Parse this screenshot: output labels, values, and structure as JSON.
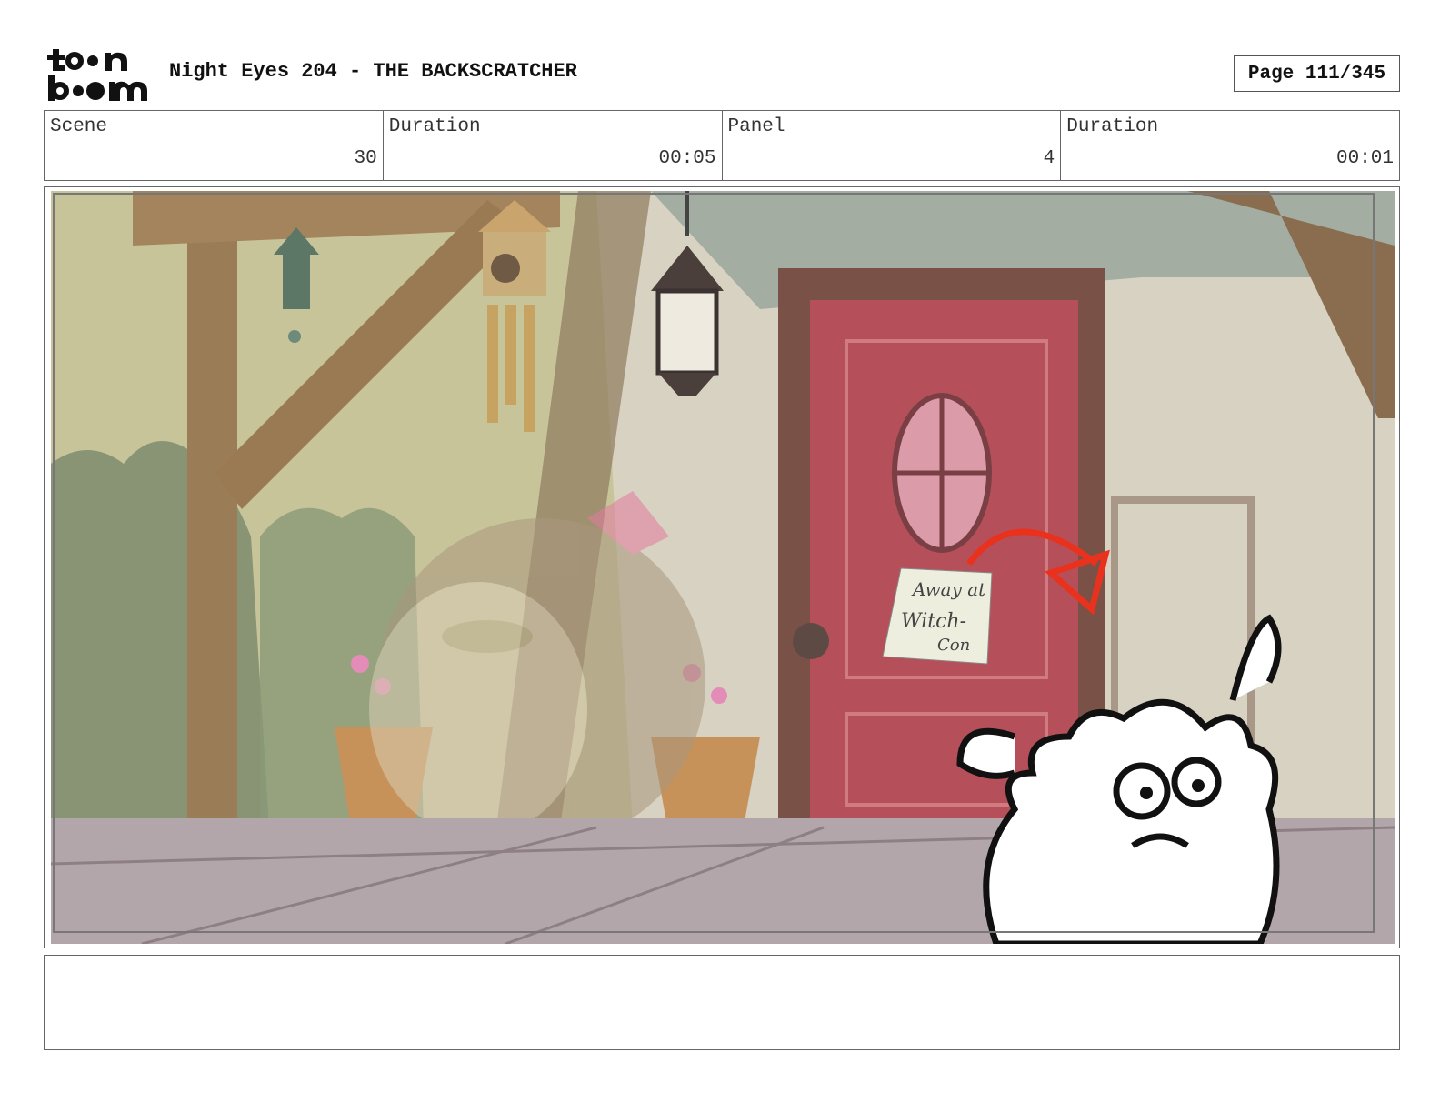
{
  "header": {
    "logo_text": "toon boom",
    "title": "Night Eyes 204 - THE BACKSCRATCHER",
    "page": "Page 111/345"
  },
  "info": {
    "scene_label": "Scene",
    "scene_value": "30",
    "scene_duration_label": "Duration",
    "scene_duration_value": "00:05",
    "panel_label": "Panel",
    "panel_value": "4",
    "panel_duration_label": "Duration",
    "panel_duration_value": "00:01"
  },
  "panel": {
    "sign_line1": "Away at",
    "sign_line2": "Witch-",
    "sign_line3": "Con"
  },
  "notes": {
    "text": ""
  },
  "colors": {
    "arrow": "#e8321e",
    "door": "#b5505a",
    "wall": "#d8d0c0",
    "floor": "#b3a6ab"
  }
}
